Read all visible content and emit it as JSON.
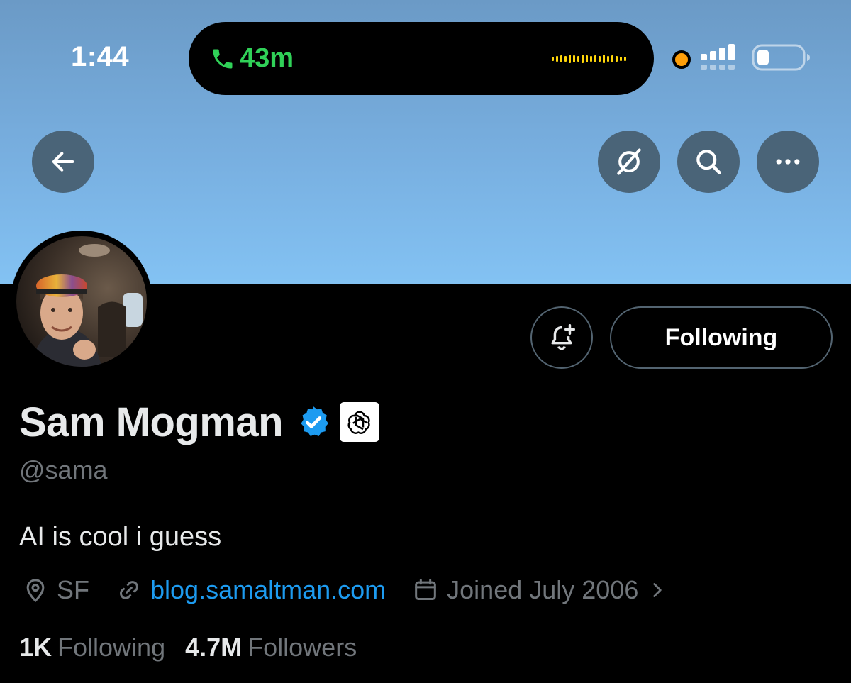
{
  "status_bar": {
    "time": "1:44",
    "call_duration": "43m"
  },
  "profile": {
    "display_name": "Sam Mogman",
    "handle": "@sama",
    "bio": "AI is cool i guess",
    "location": "SF",
    "website": "blog.samaltman.com",
    "joined": "Joined July 2006",
    "following_count": "1K",
    "following_label": "Following",
    "followers_count": "4.7M",
    "followers_label": "Followers"
  },
  "actions": {
    "follow_button_label": "Following"
  },
  "icons": {
    "back": "arrow-left-icon",
    "grok": "grok-icon",
    "search": "search-icon",
    "more": "more-icon",
    "notify": "bell-plus-icon",
    "verified": "verified-badge-icon",
    "affiliate": "openai-logo-icon",
    "location": "location-pin-icon",
    "link": "link-icon",
    "calendar": "calendar-icon",
    "chevron": "chevron-right-icon"
  },
  "colors": {
    "accent": "#1d9bf0",
    "call_green": "#30d158",
    "muted": "#71767b"
  }
}
